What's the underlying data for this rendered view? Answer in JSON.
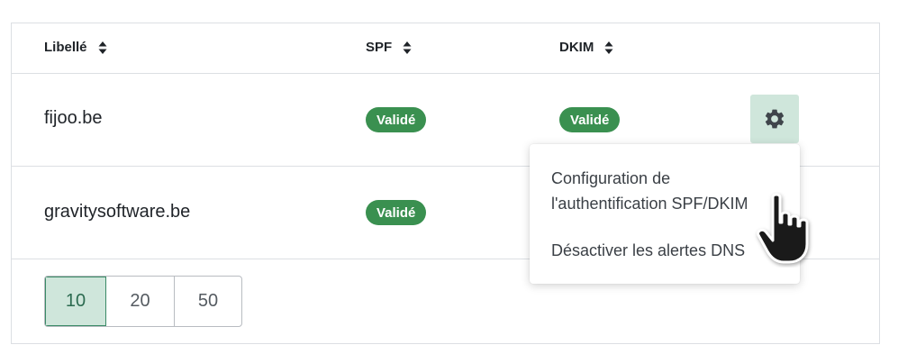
{
  "table": {
    "headers": {
      "label": "Libellé",
      "spf": "SPF",
      "dkim": "DKIM"
    },
    "rows": [
      {
        "domain": "fijoo.be",
        "spf": "Validé",
        "dkim": "Validé"
      },
      {
        "domain": "gravitysoftware.be",
        "spf": "Validé"
      }
    ]
  },
  "pagination": {
    "options": [
      "10",
      "20",
      "50"
    ],
    "selected": "10"
  },
  "context_menu": {
    "items": [
      "Configuration de\nl'authentification SPF/DKIM",
      "Désactiver les alertes DNS"
    ]
  },
  "icons": {
    "sort": "sort-icon",
    "settings": "gear-icon",
    "cursor": "hand-pointer-icon"
  },
  "colors": {
    "badge": "#3a9050",
    "gear_button_bg": "#cfe6db",
    "active_page_bg": "#cfe6db",
    "active_page_text": "#2c6b50",
    "border": "#dcdfe3"
  }
}
